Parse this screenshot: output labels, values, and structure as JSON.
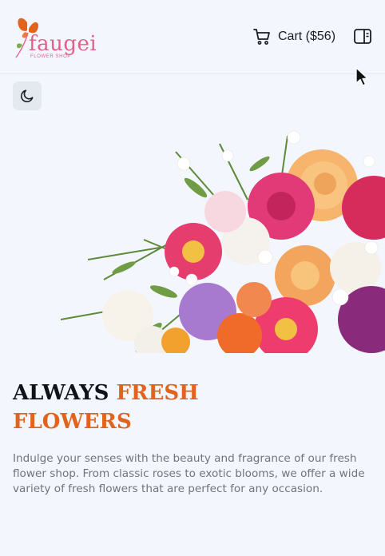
{
  "brand": {
    "name": "faugei",
    "tagline": "FLOWER SHOP",
    "colors": {
      "logo_pink": "#e0618a",
      "logo_orange": "#e2631e"
    }
  },
  "header": {
    "cart_label": "Cart ($56)",
    "cart_icon": "shopping-cart-icon",
    "menu_icon": "sidebar-toggle-icon"
  },
  "theme_toggle": {
    "icon": "moon-icon"
  },
  "hero": {
    "image": "flower-bouquet",
    "headline_part1": "ALWAYS",
    "headline_part2": "FRESH FLOWERS",
    "description": "Indulge your senses with the beauty and fragrance of our fresh flower shop. From classic roses to exotic blooms, we offer a wide variety of fresh flowers that are perfect for any occasion."
  },
  "colors": {
    "accent": "#e2631e",
    "background": "#f3f6fd",
    "heading": "#111318",
    "body_text": "#70747d"
  }
}
